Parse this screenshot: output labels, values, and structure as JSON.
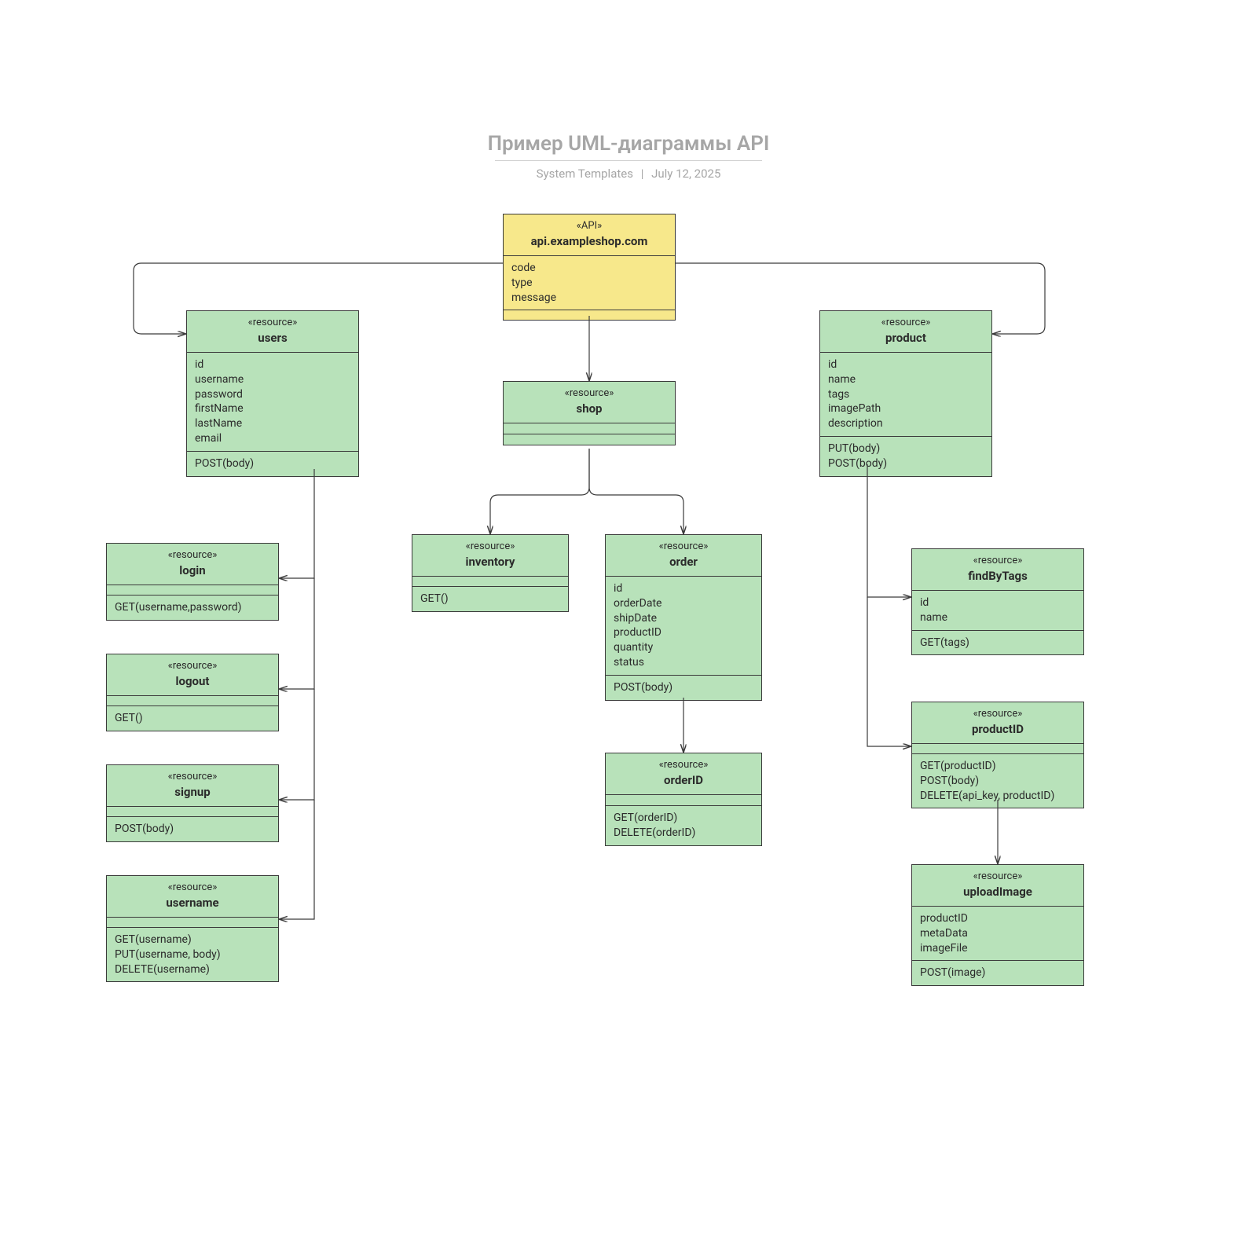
{
  "title": "Пример UML-диаграммы API",
  "subtitle_author": "System Templates",
  "subtitle_date": "July 12, 2025",
  "api": {
    "stereotype": "«API»",
    "name": "api.exampleshop.com",
    "attrs": [
      "code",
      "type",
      "message"
    ]
  },
  "users": {
    "stereotype": "«resource»",
    "name": "users",
    "attrs": [
      "id",
      "username",
      "password",
      "firstName",
      "lastName",
      "email"
    ],
    "ops": [
      "POST(body)"
    ]
  },
  "shop": {
    "stereotype": "«resource»",
    "name": "shop"
  },
  "product": {
    "stereotype": "«resource»",
    "name": "product",
    "attrs": [
      "id",
      "name",
      "tags",
      "imagePath",
      "description"
    ],
    "ops": [
      "PUT(body)",
      "POST(body)"
    ]
  },
  "login": {
    "stereotype": "«resource»",
    "name": "login",
    "ops": [
      "GET(username,password)"
    ]
  },
  "logout": {
    "stereotype": "«resource»",
    "name": "logout",
    "ops": [
      "GET()"
    ]
  },
  "signup": {
    "stereotype": "«resource»",
    "name": "signup",
    "ops": [
      "POST(body)"
    ]
  },
  "username": {
    "stereotype": "«resource»",
    "name": "username",
    "ops": [
      "GET(username)",
      "PUT(username, body)",
      "DELETE(username)"
    ]
  },
  "inventory": {
    "stereotype": "«resource»",
    "name": "inventory",
    "ops": [
      "GET()"
    ]
  },
  "order": {
    "stereotype": "«resource»",
    "name": "order",
    "attrs": [
      "id",
      "orderDate",
      "shipDate",
      "productID",
      "quantity",
      "status"
    ],
    "ops": [
      "POST(body)"
    ]
  },
  "orderID": {
    "stereotype": "«resource»",
    "name": "orderID",
    "ops": [
      "GET(orderID)",
      "DELETE(orderID)"
    ]
  },
  "findByTags": {
    "stereotype": "«resource»",
    "name": "findByTags",
    "attrs": [
      "id",
      "name"
    ],
    "ops": [
      "GET(tags)"
    ]
  },
  "productID": {
    "stereotype": "«resource»",
    "name": "productID",
    "ops": [
      "GET(productID)",
      "POST(body)",
      "DELETE(api_key, productID)"
    ]
  },
  "uploadImage": {
    "stereotype": "«resource»",
    "name": "uploadImage",
    "attrs": [
      "productID",
      "metaData",
      "imageFile"
    ],
    "ops": [
      "POST(image)"
    ]
  }
}
